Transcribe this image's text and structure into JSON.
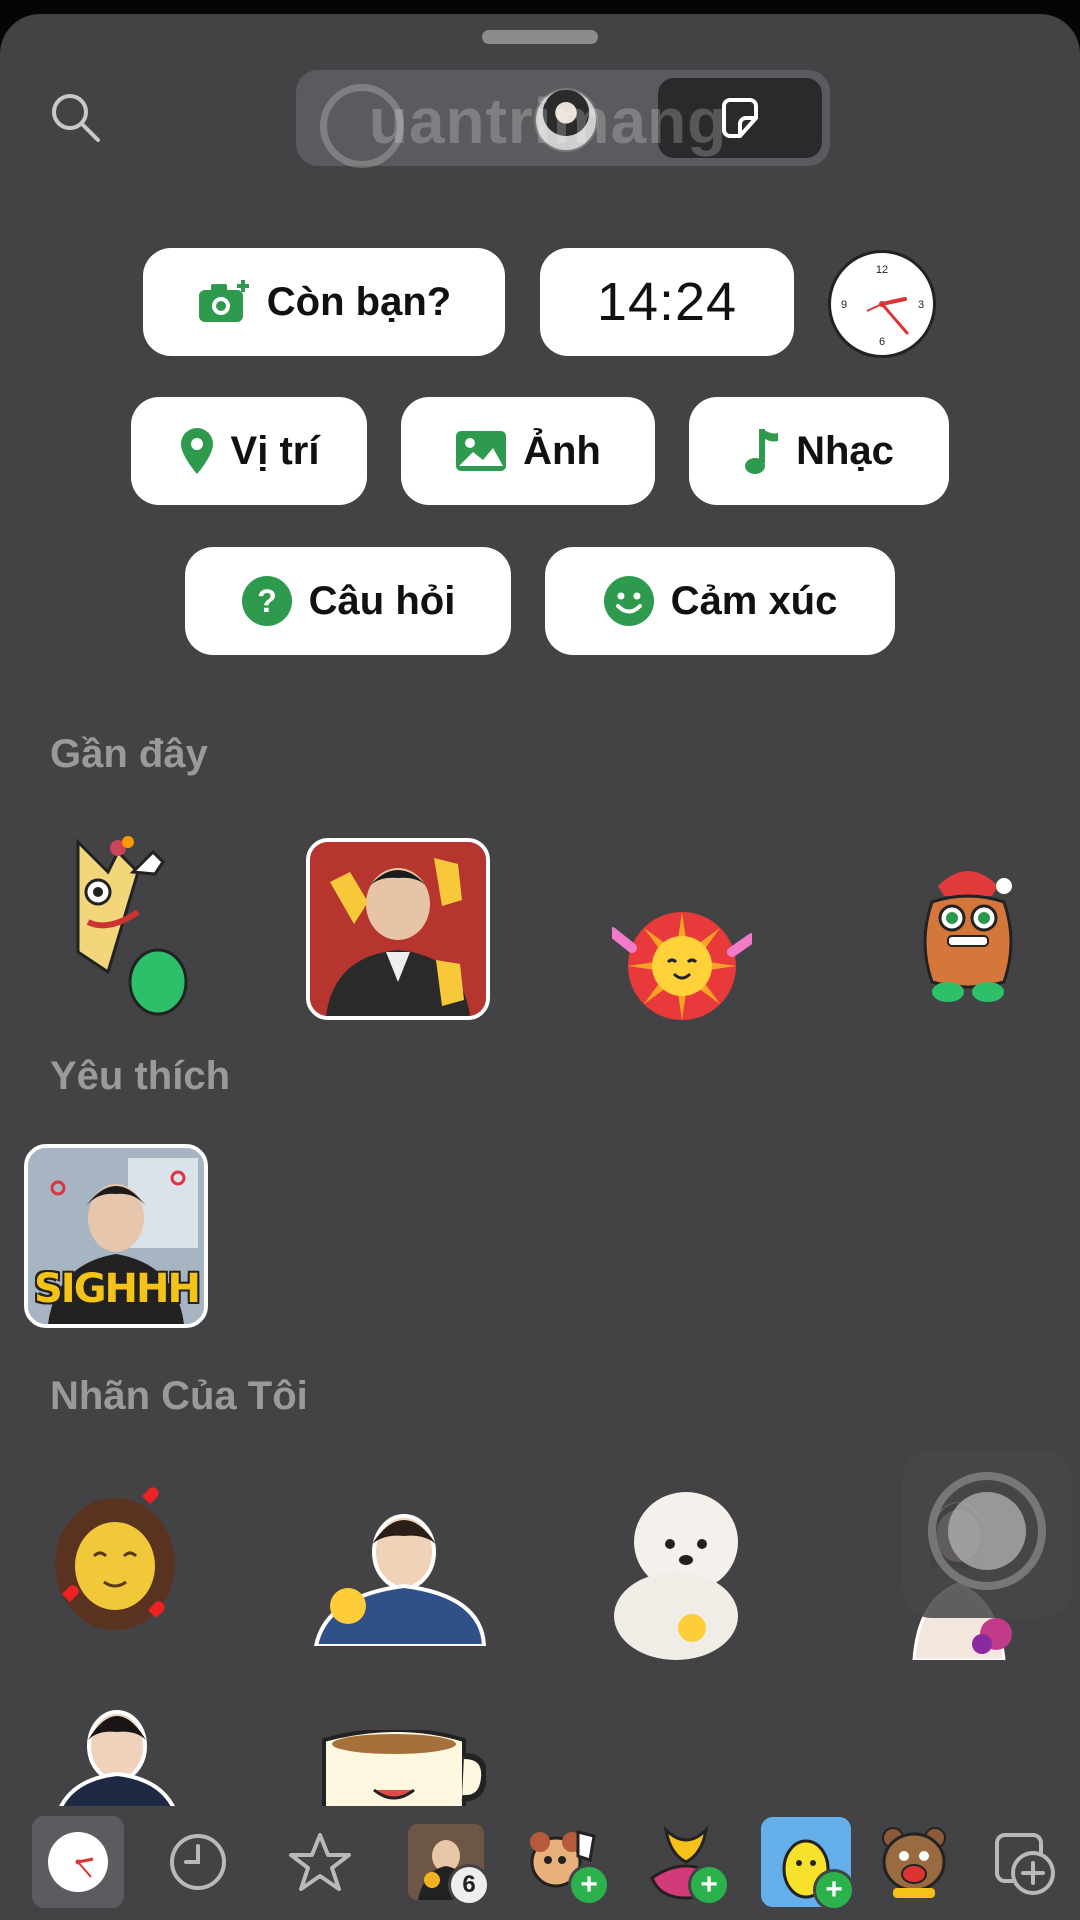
{
  "header": {
    "watermark": "uantrimang"
  },
  "quick_stickers": {
    "add_yours": "Còn bạn?",
    "time": "14:24",
    "location": "Vị trí",
    "photo": "Ảnh",
    "music": "Nhạc",
    "question": "Câu hỏi",
    "emotion": "Cảm xúc"
  },
  "sections": {
    "recent": "Gần đây",
    "favorites": "Yêu thích",
    "my_stickers": "Nhãn Của Tôi"
  },
  "favorite_caption": "SIGHHH",
  "tabbar": {
    "pack_count": "6"
  },
  "colors": {
    "accent_green": "#2d9a4d",
    "sheet_bg": "#434244"
  },
  "icons": [
    "search-icon",
    "avatar-icon",
    "sticker-icon",
    "camera-plus-icon",
    "clock-icon",
    "map-pin-icon",
    "image-icon",
    "music-note-icon",
    "question-icon",
    "smile-icon",
    "star-icon",
    "history-icon",
    "add-sticker-icon"
  ]
}
